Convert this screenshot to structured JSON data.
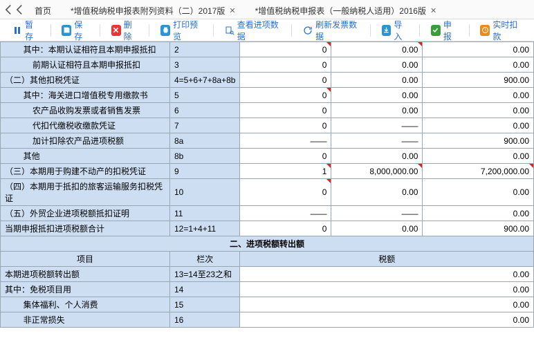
{
  "tabs": {
    "home": "首页",
    "t1": "*增值税纳税申报表附列资料（二）2017版",
    "t2": "*增值税纳税申报表（一般纳税人适用）2016版"
  },
  "toolbar": {
    "tempSave": "暂存",
    "save": "保存",
    "delete": "删除",
    "printPreview": "打印预览",
    "viewInput": "查看进项数据",
    "refreshInvoice": "刷新发票数据",
    "import": "导入",
    "declare": "申报",
    "realtimeDeduct": "实时扣款"
  },
  "rows": [
    {
      "label": "其中：本期认证相符且本期申报抵扣",
      "col": "2",
      "v": [
        "0",
        "0.00",
        "0.00"
      ],
      "indent": 2,
      "corner": [
        0,
        1
      ]
    },
    {
      "label": "前期认证相符且本期申报抵扣",
      "col": "3",
      "v": [
        "0",
        "0.00",
        "0.00"
      ],
      "indent": 3
    },
    {
      "label": "（二）其他扣税凭证",
      "col": "4=5+6+7+8a+8b",
      "v": [
        "0",
        "0.00",
        "900.00"
      ],
      "indent": 0
    },
    {
      "label": "其中：海关进口增值税专用缴款书",
      "col": "5",
      "v": [
        "0",
        "0.00",
        "0.00"
      ],
      "indent": 2,
      "corner": [
        0
      ]
    },
    {
      "label": "农产品收购发票或者销售发票",
      "col": "6",
      "v": [
        "0",
        "0.00",
        "0.00"
      ],
      "indent": 3
    },
    {
      "label": "代扣代缴税收缴款凭证",
      "col": "7",
      "v": [
        "0",
        "——",
        "0.00"
      ],
      "indent": 3,
      "dash": [
        1
      ]
    },
    {
      "label": "加计扣除农产品进项税额",
      "col": "8a",
      "v": [
        "——",
        "——",
        "900.00"
      ],
      "indent": 3,
      "dash": [
        0,
        1
      ]
    },
    {
      "label": "其他",
      "col": "8b",
      "v": [
        "0",
        "0.00",
        "0.00"
      ],
      "indent": 2
    },
    {
      "label": "（三）本期用于购建不动产的扣税凭证",
      "col": "9",
      "v": [
        "1",
        "8,000,000.00",
        "7,200,000.00"
      ],
      "indent": 0,
      "corner": [
        0,
        1,
        2
      ]
    },
    {
      "label": "（四）本期用于抵扣的旅客运输服务扣税凭证",
      "col": "10",
      "v": [
        "0",
        "0.00",
        "0.00"
      ],
      "indent": 0,
      "corner": [
        0
      ]
    },
    {
      "label": "（五）外贸企业进项税额抵扣证明",
      "col": "11",
      "v": [
        "——",
        "——",
        "0.00"
      ],
      "indent": 0,
      "dash": [
        0,
        1
      ]
    },
    {
      "label": "当期申报抵扣进项税额合计",
      "col": "12=1+4+11",
      "v": [
        "0",
        "0.00",
        "900.00"
      ],
      "indent": 0
    }
  ],
  "section2": {
    "title": "二、进项税额转出额",
    "colItem": "项目",
    "colNo": "栏次",
    "colTax": "税额"
  },
  "rows2": [
    {
      "label": "本期进项税额转出额",
      "col": "13=14至23之和",
      "v": "0.00",
      "indent": 0
    },
    {
      "label": "其中：免税项目用",
      "col": "14",
      "v": "0.00",
      "indent": 0
    },
    {
      "label": "集体福利、个人消费",
      "col": "15",
      "v": "0.00",
      "indent": 2
    },
    {
      "label": "非正常损失",
      "col": "16",
      "v": "0.00",
      "indent": 2
    }
  ]
}
